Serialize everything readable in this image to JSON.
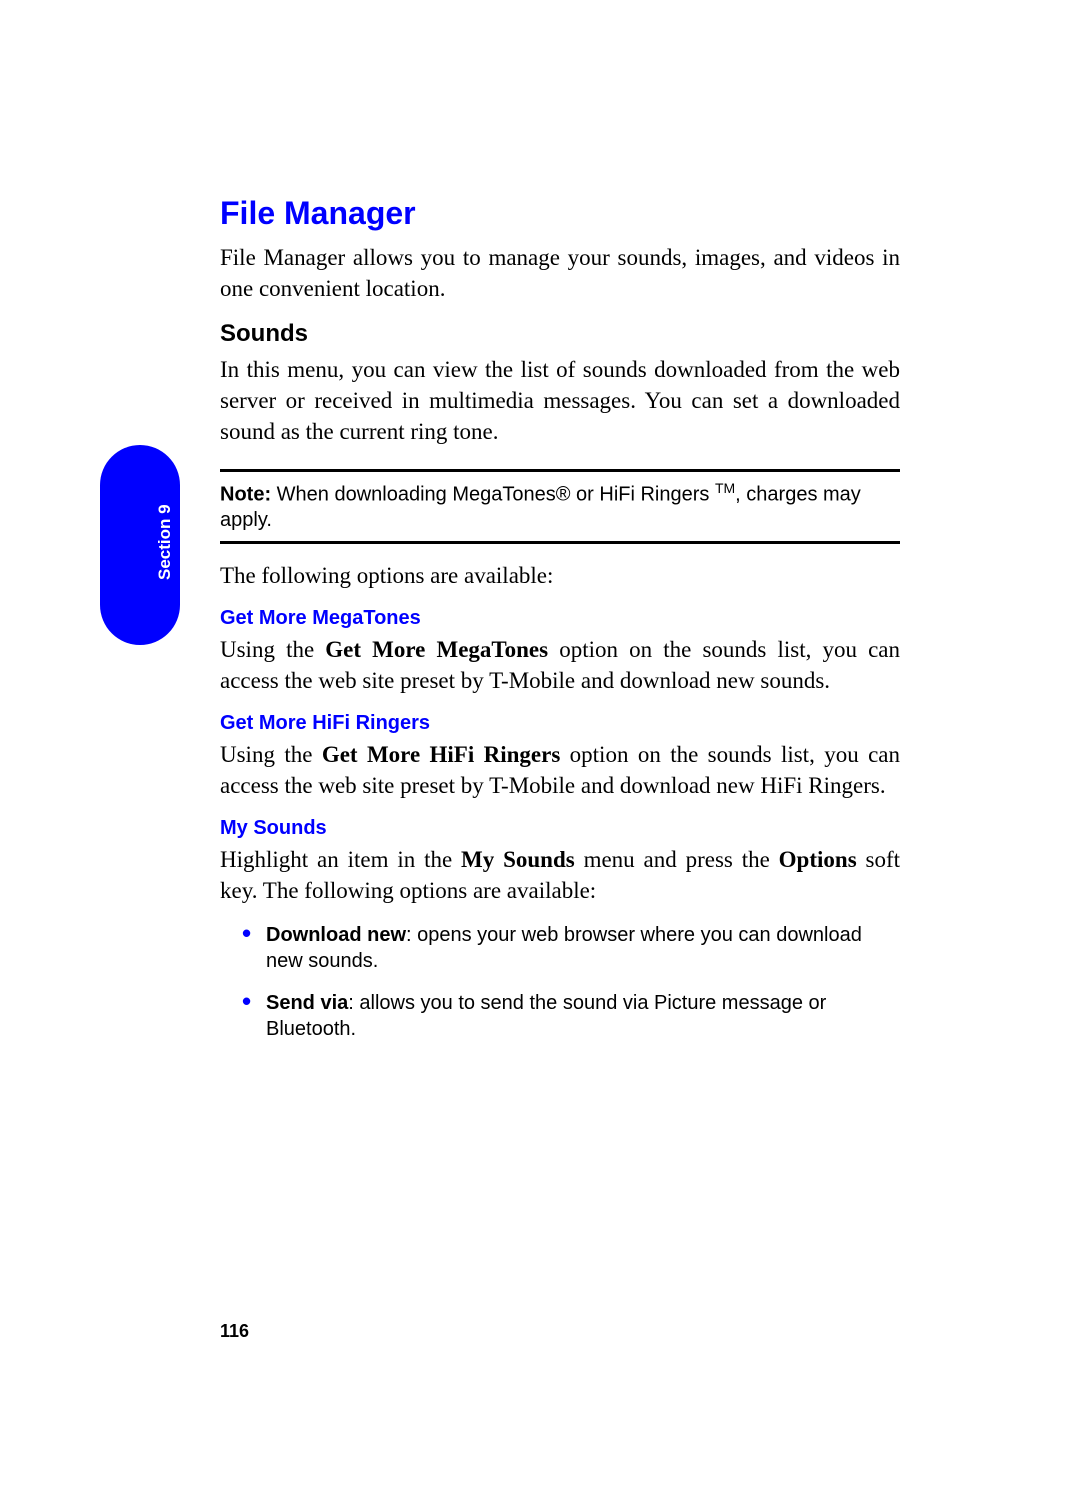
{
  "section_tab": "Section 9",
  "h1": "File Manager",
  "p_intro": "File Manager allows you to manage your sounds, images, and videos in one convenient location.",
  "h2_sounds": "Sounds",
  "p_sounds": "In this menu, you can view the list of sounds downloaded from the web server or received in multimedia messages. You can set a downloaded sound as the current ring tone.",
  "note": {
    "label": "Note:",
    "text_before_tm": " When downloading MegaTones® or HiFi Ringers ",
    "tm": "TM",
    "text_after_tm": ", charges may apply."
  },
  "p_following": "The following options are available:",
  "h3_megatones": "Get More MegaTones",
  "mega": {
    "pre": "Using the ",
    "bold": "Get More MegaTones",
    "post": " option on the sounds list, you can access the web site preset by T-Mobile and download new sounds."
  },
  "h3_hifi": "Get More HiFi Ringers",
  "hifi": {
    "pre": "Using the ",
    "bold": "Get More HiFi Ringers",
    "post": " option on the sounds list, you can access the web site preset by T-Mobile and download new HiFi Ringers."
  },
  "h3_mysounds": "My Sounds",
  "mys": {
    "t1": "Highlight an item in the ",
    "b1": "My Sounds",
    "t2": " menu and press the ",
    "b2": "Options",
    "t3": " soft key. The following options are available:"
  },
  "bullets": [
    {
      "title": "Download new",
      "desc": ": opens your web browser where you can download new sounds."
    },
    {
      "title": "Send via",
      "desc": ": allows you to send the sound via Picture message or Bluetooth."
    }
  ],
  "page_number": "116"
}
